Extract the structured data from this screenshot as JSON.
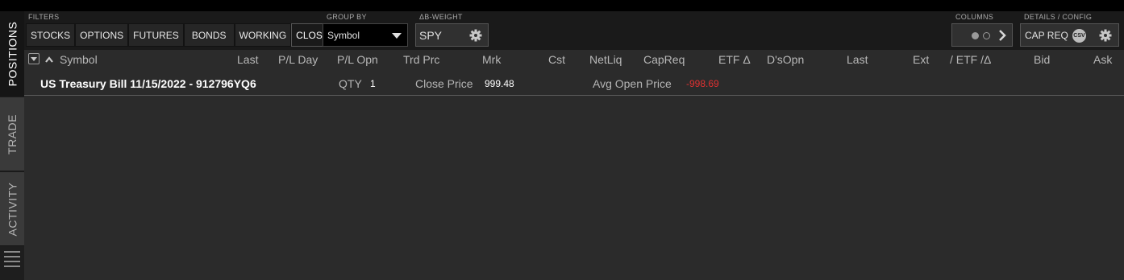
{
  "tabs": [
    {
      "label": "POSITIONS",
      "active": true
    },
    {
      "label": "TRADE",
      "active": false
    },
    {
      "label": "ACTIVITY",
      "active": false
    }
  ],
  "filters": {
    "label": "FILTERS",
    "items": [
      "STOCKS",
      "OPTIONS",
      "FUTURES",
      "BONDS",
      "WORKING",
      "CLOSED"
    ],
    "selected": "CLOSED"
  },
  "group_by": {
    "label": "GROUP BY",
    "value": "Symbol"
  },
  "beta_weight": {
    "label": "ΔΒ-WEIGHT",
    "value": "SPY"
  },
  "columns": {
    "label": "COLUMNS"
  },
  "details": {
    "label": "DETAILS / CONFIG",
    "value": "CAP REQ",
    "csv": "CSV"
  },
  "table": {
    "headers": [
      "Symbol",
      "Last",
      "P/L Day",
      "P/L Opn",
      "Trd Prc",
      "Mrk",
      "Cst",
      "NetLiq",
      "CapReq",
      "ETF Δ",
      "D'sOpn",
      "Last",
      "Ext",
      "/ ETF /Δ",
      "Bid",
      "Ask"
    ],
    "rows": [
      {
        "symbol": "US Treasury Bill 11/15/2022 - 912796YQ6",
        "qty_label": "QTY",
        "qty": "1",
        "close_label": "Close Price",
        "close_price": "999.48",
        "avg_label": "Avg Open Price",
        "avg_open_price": "-998.69"
      }
    ]
  },
  "colors": {
    "negative": "#e03131",
    "background": "#2b2b2b",
    "toolbar": "#1a1a1a"
  }
}
